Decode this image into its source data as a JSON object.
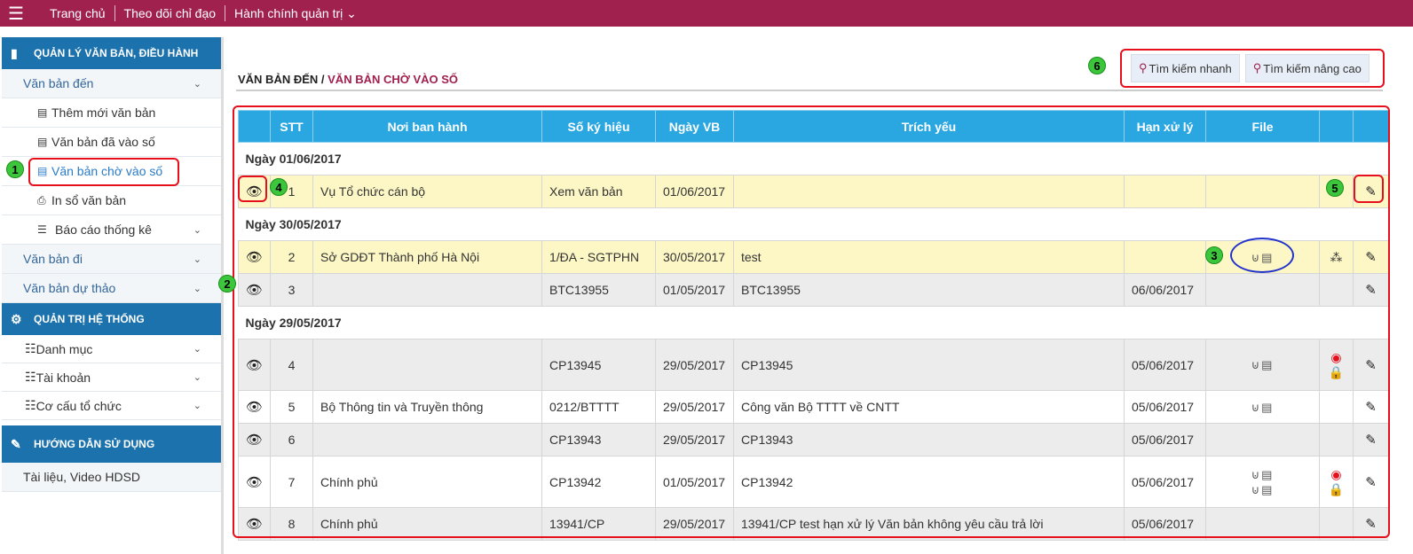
{
  "topbar": {
    "menu_icon": "hamburger-icon",
    "nav": [
      "Trang chủ",
      "Theo dõi chỉ đạo",
      "Hành chính quản trị"
    ]
  },
  "sidebar": {
    "section1": "QUẢN LÝ VĂN BẢN, ĐIỀU HÀNH",
    "van_ban_den": "Văn bản đến",
    "sub": [
      "Thêm mới văn bản",
      "Văn bản đã vào số",
      "Văn bản chờ vào số",
      "In sổ văn bản",
      "Báo cáo thống kê"
    ],
    "van_ban_di": "Văn bản đi",
    "van_ban_du_thao": "Văn bản dự thảo",
    "section2": "QUẢN TRỊ HỆ THỐNG",
    "sys": [
      "Danh mục",
      "Tài khoản",
      "Cơ cấu tổ chức"
    ],
    "section3": "HƯỚNG DẪN SỬ DỤNG",
    "help": "Tài liệu, Video HDSD"
  },
  "breadcrumb": {
    "parent": "VĂN BẢN ĐẾN",
    "sep": " / ",
    "current": "VĂN BẢN CHỜ VÀO SỐ"
  },
  "search": {
    "quick": "Tìm kiếm nhanh",
    "advanced": "Tìm kiếm nâng cao"
  },
  "table": {
    "headers": [
      "",
      "STT",
      "Nơi ban hành",
      "Số ký hiệu",
      "Ngày VB",
      "Trích yếu",
      "Hạn xử lý",
      "File",
      "",
      ""
    ],
    "groups": [
      "Ngày 01/06/2017",
      "Ngày 30/05/2017",
      "Ngày 29/05/2017"
    ],
    "rows": [
      {
        "stt": "1",
        "noi": "Vụ Tổ chức cán bộ",
        "so": "Xem văn bản",
        "ngay": "01/06/2017",
        "trich": "",
        "han": ""
      },
      {
        "stt": "2",
        "noi": "Sở GDĐT Thành phố Hà Nội",
        "so": "1/ĐA - SGTPHN",
        "ngay": "30/05/2017",
        "trich": "test",
        "han": ""
      },
      {
        "stt": "3",
        "noi": "",
        "so": "BTC13955",
        "ngay": "01/05/2017",
        "trich": "BTC13955",
        "han": "06/06/2017"
      },
      {
        "stt": "4",
        "noi": "",
        "so": "CP13945",
        "ngay": "29/05/2017",
        "trich": "CP13945",
        "han": "05/06/2017"
      },
      {
        "stt": "5",
        "noi": "Bộ Thông tin và Truyền thông",
        "so": "0212/BTTTT",
        "ngay": "29/05/2017",
        "trich": "Công văn Bộ TTTT về CNTT",
        "han": "05/06/2017"
      },
      {
        "stt": "6",
        "noi": "",
        "so": "CP13943",
        "ngay": "29/05/2017",
        "trich": "CP13943",
        "han": "05/06/2017"
      },
      {
        "stt": "7",
        "noi": "Chính phủ",
        "so": "CP13942",
        "ngay": "01/05/2017",
        "trich": "CP13942",
        "han": "05/06/2017"
      },
      {
        "stt": "8",
        "noi": "Chính phủ",
        "so": "13941/CP",
        "ngay": "29/05/2017",
        "trich": "13941/CP test hạn xử lý Văn bản không yêu cầu trả lời",
        "han": "05/06/2017"
      }
    ]
  },
  "callouts": [
    "1",
    "2",
    "3",
    "4",
    "5",
    "6"
  ],
  "colors": {
    "brand": "#a0204e",
    "header": "#2aa7e0",
    "section": "#1c72ad",
    "highlight": "#e5101c"
  }
}
